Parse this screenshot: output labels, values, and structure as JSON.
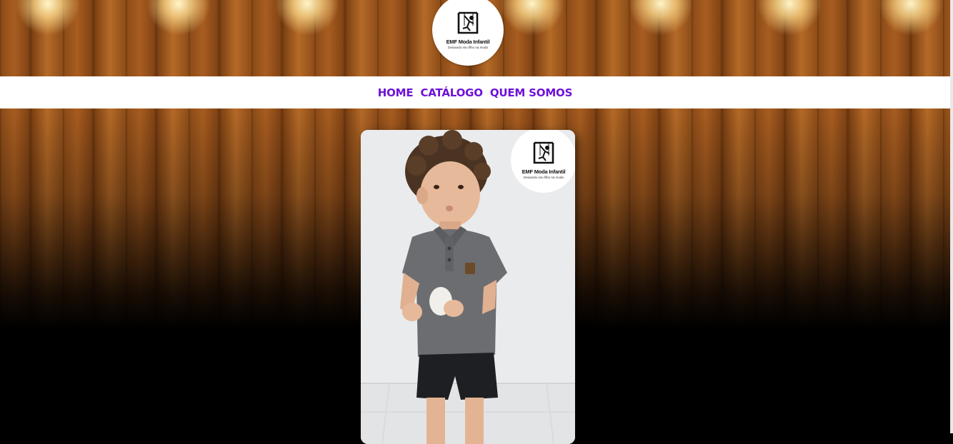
{
  "header": {
    "logo": {
      "brand": "EMF Moda Infantil",
      "tagline": "Deixando seu filho na moda",
      "icon": "swing-child-icon"
    }
  },
  "nav": {
    "items": [
      {
        "label": "HOME"
      },
      {
        "label": "CATÁLOGO"
      },
      {
        "label": "QUEM SOMOS"
      }
    ],
    "link_color": "#6e12d8"
  },
  "product": {
    "image_alt": "Criança vestindo camisa polo cinza e bermuda preta",
    "watermark": {
      "brand": "EMF Moda Infantil",
      "tagline": "Deixando seu filho na moda"
    }
  }
}
